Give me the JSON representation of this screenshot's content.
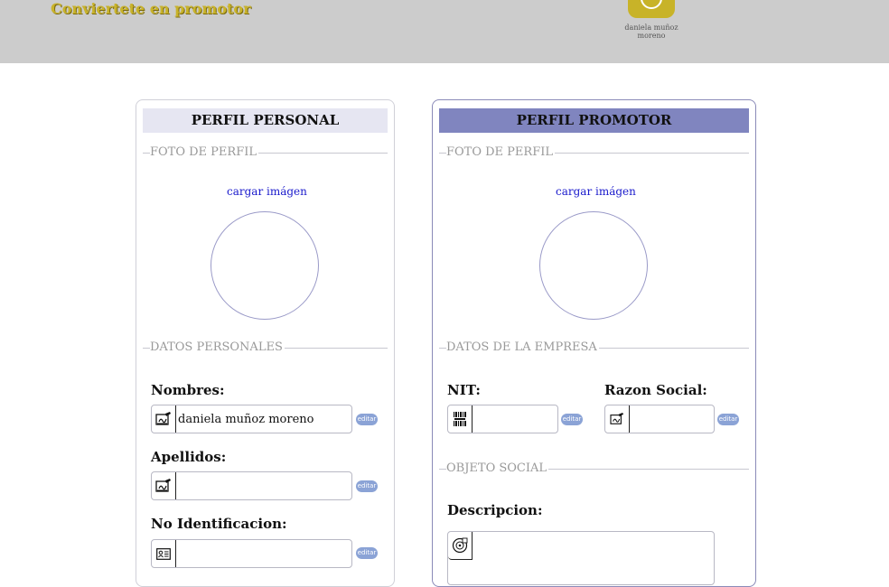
{
  "header": {
    "brand": "Conviertete en promotor",
    "user_name": "daniela muñoz moreno",
    "avatar_color": "#c8b328"
  },
  "personal": {
    "title": "PERFIL PERSONAL",
    "photo_section": "FOTO DE PERFIL",
    "upload_link": "cargar imágen",
    "data_section": "DATOS PERSONALES",
    "fields": [
      {
        "label": "Nombres:",
        "value": "daniela muñoz moreno",
        "icon": "signature-icon",
        "edit": "editar"
      },
      {
        "label": "Apellidos:",
        "value": "",
        "icon": "signature-icon",
        "edit": "editar"
      },
      {
        "label": "No Identificacion:",
        "value": "",
        "icon": "id-card-icon",
        "edit": "editar"
      }
    ]
  },
  "promotor": {
    "title": "PERFIL PROMOTOR",
    "photo_section": "FOTO DE PERFIL",
    "upload_link": "cargar imágen",
    "company_section": "DATOS DE LA EMPRESA",
    "nit": {
      "label": "NIT:",
      "value": "",
      "icon": "barcode-icon",
      "edit": "editar"
    },
    "razon": {
      "label": "Razon Social:",
      "value": "",
      "icon": "signature-icon",
      "edit": "editar"
    },
    "object_section": "OBJETO SOCIAL",
    "descripcion": {
      "label": "Descripcion:",
      "value": "",
      "icon": "disc-icon"
    }
  },
  "colors": {
    "accent_personal": "#e6e6f2",
    "accent_promotor": "#8085bf",
    "edit_badge": "#8ba3d6",
    "link": "#1a1acc"
  }
}
